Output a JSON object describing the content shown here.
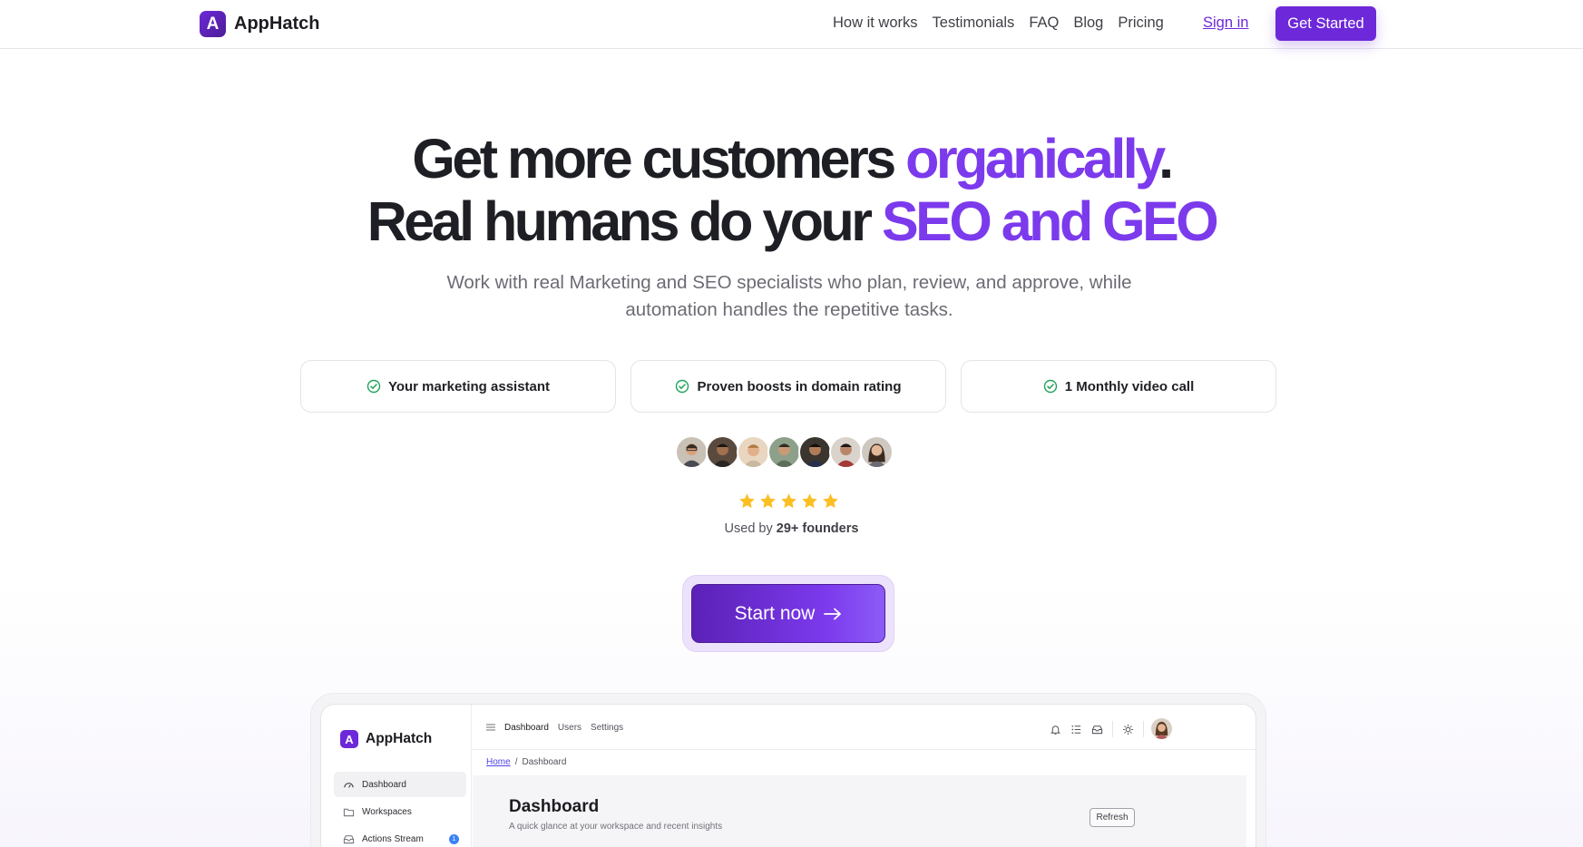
{
  "nav": {
    "brand": "AppHatch",
    "brand_initial": "A",
    "links": [
      "How it works",
      "Testimonials",
      "FAQ",
      "Blog",
      "Pricing"
    ],
    "sign_in": "Sign in",
    "get_started": "Get Started"
  },
  "hero": {
    "line1_plain": "Get more customers ",
    "line1_accent": "organically",
    "line1_end": ".",
    "line2_plain": "Real humans do your ",
    "line2_accent": "SEO and GEO",
    "subtitle": "Work with real Marketing and SEO specialists who plan, review, and approve, while automation handles the repetitive tasks.",
    "accent_color": "#7c3aed"
  },
  "features": [
    "Your marketing assistant",
    "Proven boosts in domain rating",
    "1 Monthly video call"
  ],
  "social_proof": {
    "rating_stars": 5,
    "used_by_prefix": "Used by ",
    "used_by_count": "29+ founders"
  },
  "cta": {
    "label": "Start now",
    "icon": "arrow-right-icon"
  },
  "preview": {
    "brand": "AppHatch",
    "brand_initial": "A",
    "sidebar": [
      {
        "label": "Dashboard",
        "icon": "dashboard-icon"
      },
      {
        "label": "Workspaces",
        "icon": "folder-icon"
      },
      {
        "label": "Actions Stream",
        "icon": "inbox-icon",
        "badge": "1"
      }
    ],
    "tabs": [
      "Dashboard",
      "Users",
      "Settings"
    ],
    "breadcrumb": {
      "home": "Home",
      "sep": "/",
      "current": "Dashboard"
    },
    "page_title": "Dashboard",
    "page_subtitle": "A quick glance at your workspace and recent insights",
    "refresh": "Refresh"
  }
}
